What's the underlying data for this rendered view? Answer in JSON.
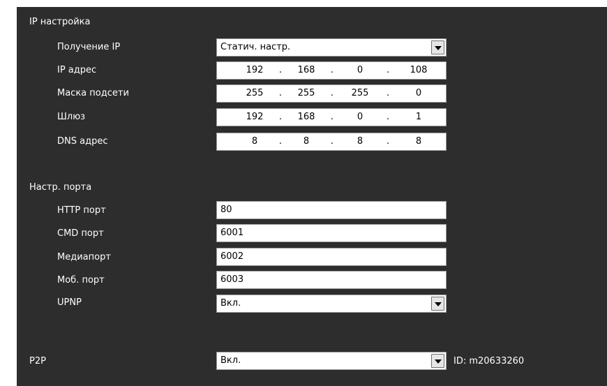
{
  "ip_section": {
    "title": "IP настройка",
    "obtain_ip": {
      "label": "Получение IP",
      "value": "Статич. настр."
    },
    "ip_address": {
      "label": "IP адрес",
      "octets": [
        "192",
        "168",
        "0",
        "108"
      ]
    },
    "subnet_mask": {
      "label": "Маска подсети",
      "octets": [
        "255",
        "255",
        "255",
        "0"
      ]
    },
    "gateway": {
      "label": "Шлюз",
      "octets": [
        "192",
        "168",
        "0",
        "1"
      ]
    },
    "dns": {
      "label": "DNS адрес",
      "octets": [
        "8",
        "8",
        "8",
        "8"
      ]
    },
    "separator": "."
  },
  "port_section": {
    "title": "Настр. порта",
    "http": {
      "label": "HTTP порт",
      "value": "80"
    },
    "cmd": {
      "label": "CMD порт",
      "value": "6001"
    },
    "media": {
      "label": "Медиапорт",
      "value": "6002"
    },
    "mobile": {
      "label": "Моб. порт",
      "value": "6003"
    },
    "upnp": {
      "label": "UPNP",
      "value": "Вкл."
    }
  },
  "p2p": {
    "label": "P2P",
    "value": "Вкл.",
    "id_text": "ID: m20633260"
  },
  "colors": {
    "panel_bg": "#2d2d2d",
    "label_text": "#ffffff",
    "field_bg": "#ffffff"
  }
}
